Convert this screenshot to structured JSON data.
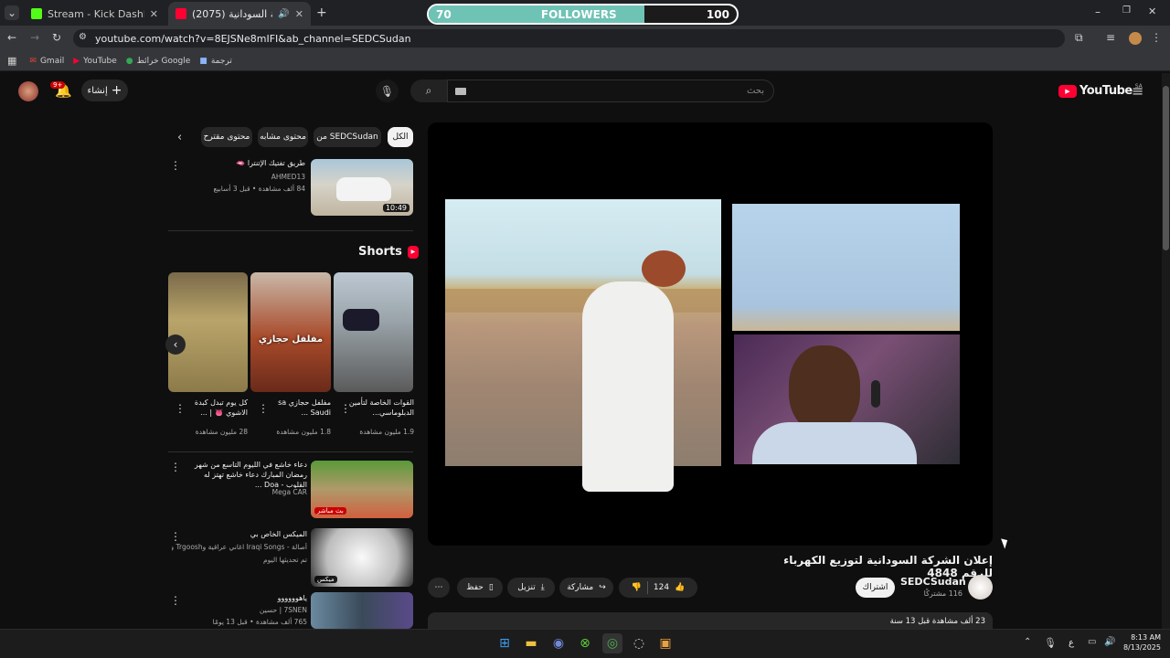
{
  "browser": {
    "tabs": [
      {
        "title": "Stream - Kick Dashboard",
        "active": false,
        "favicon_color": "#53fc18"
      },
      {
        "title": "(2075) إعلان الشركة السودانية",
        "active": true,
        "favicon_color": "#ff0033"
      }
    ],
    "new_tab": "+",
    "url": "youtube.com/watch?v=8EJSNe8mIFI&ab_channel=SEDCSudan",
    "bookmarks": [
      "Gmail",
      "YouTube",
      "خرائط Google",
      "ترجمة"
    ]
  },
  "followers_overlay": {
    "current": "70",
    "label": "FOLLOWERS",
    "goal": "100",
    "progress": 0.7,
    "color": "#6fc3b5"
  },
  "youtube": {
    "logo": "YouTube",
    "region": "SA",
    "search_placeholder": "بحث",
    "create_label": "إنشاء",
    "notifications_badge": "9+",
    "video": {
      "title": "إعلان الشركة السودانية لتوزيع الكهرباء للرقم 4848",
      "channel": "SEDCSudan",
      "subscribers": "116 مشتركًا",
      "subscribe_label": "اشتراك",
      "likes": "124",
      "share_label": "مشاركة",
      "download_label": "تنزيل",
      "save_label": "حفظ",
      "description_meta": "23 ألف مشاهدة  قبل 13 سنة"
    },
    "filter_chips": [
      "الكل",
      "من SEDCSudan",
      "محتوى مشابه",
      "محتوى مقترح"
    ],
    "recommendations": [
      {
        "title": "طريق تفتيك الإتنترا 🫦",
        "channel": "AHMED13",
        "meta": "84 ألف مشاهدة • قبل 3 أسابيع",
        "duration": "10:49"
      }
    ],
    "shorts_heading": "Shorts",
    "shorts": [
      {
        "title": "القوات الخاصة لتأمين الدبلوماسي...",
        "views": "1.9 مليون مشاهدة",
        "overlay": ""
      },
      {
        "title": "مفلفل حجازي sa Saudi ...",
        "views": "1.8 مليون مشاهدة",
        "overlay": "مفلفل حجازي"
      },
      {
        "title": "كل يوم تبدل كبدة الاشوي 👅 | ...",
        "views": "28 مليون مشاهدة",
        "overlay": ""
      }
    ],
    "more_recommendations": [
      {
        "title": "دعاء خاشع في الليوم التاسع من شهر رمضان المبارك دعاء خاشع تهتز له القلوب - Doa ...",
        "channel": "Mega CAR",
        "meta": "",
        "badge": "بث مباشر"
      },
      {
        "title": "الميكس الخاص بي",
        "channel": "أصالة - Iraqi Songs اغاني عراقية وTrgoosh وأغ...",
        "meta": "تم تحديثها اليوم",
        "badge": "ميكس"
      },
      {
        "title": "ياهوووووو",
        "channel": "7SNEN | حسين",
        "meta": "765 ألف مشاهدة • قبل 13 يومًا",
        "badge": ""
      }
    ]
  },
  "taskbar": {
    "time": "8:13 AM",
    "date": "8/13/2025",
    "lang": "ع"
  }
}
